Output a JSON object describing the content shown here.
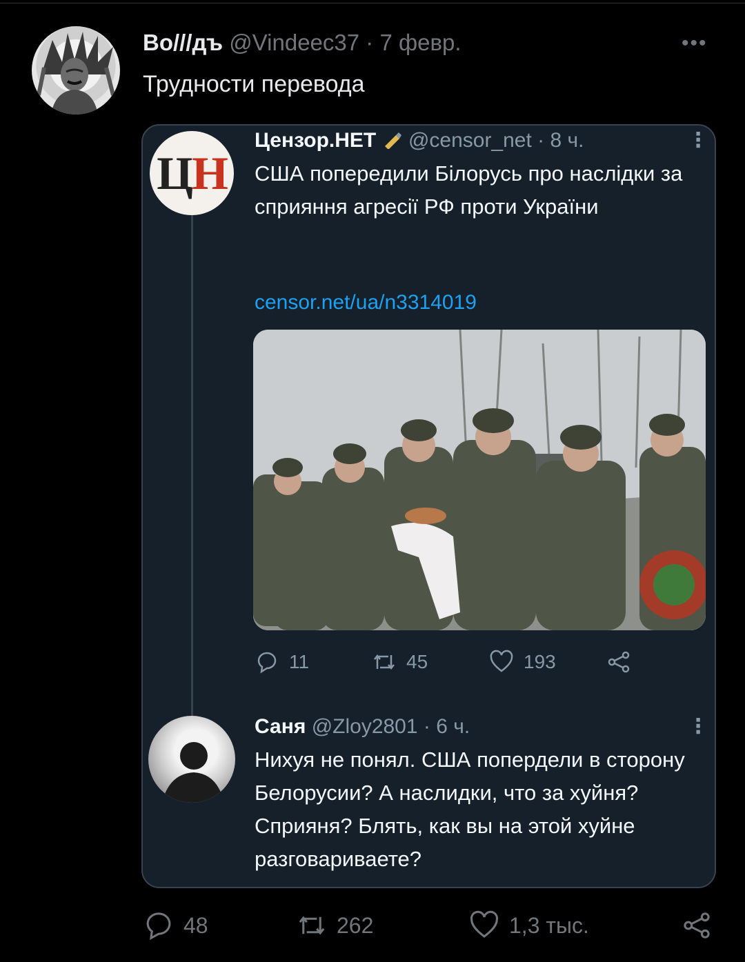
{
  "tweet": {
    "author_name": "Bo///дъ",
    "handle": "@Vindeec37",
    "date": "7 февр.",
    "separator": "·",
    "more": "•••",
    "text": "Трудности перевода",
    "avatar_icon": "portrait-headdress-avatar",
    "actions": {
      "reply_count": "48",
      "retweet_count": "262",
      "like_count": "1,3 тыс."
    }
  },
  "embedded_screenshot": {
    "quoted": {
      "avatar_text": {
        "first": "Ц",
        "second": "Н"
      },
      "author_name": "Цензор.НЕТ",
      "handle": "@censor_net",
      "time": "8 ч.",
      "separator": "·",
      "text": "США попередили Білорусь про наслідки за сприяння агресії РФ проти України",
      "link": "censor.net/ua/n3314019",
      "photo_icon": "soldiers-photo",
      "actions": {
        "reply_count": "11",
        "retweet_count": "45",
        "like_count": "193"
      }
    },
    "reply": {
      "author_name": "Саня",
      "handle": "@Zloy2801",
      "time": "6 ч.",
      "separator": "·",
      "text": "Нихуя не понял. США попердели в сторону Белорусии? А наслидки, что за хуйня? Сприяня? Блять, как вы на этой хуйне разговариваете?"
    },
    "colors": {
      "background": "#15202b",
      "link": "#1da1f2",
      "muted": "#8899a6",
      "border": "#38444d"
    }
  }
}
